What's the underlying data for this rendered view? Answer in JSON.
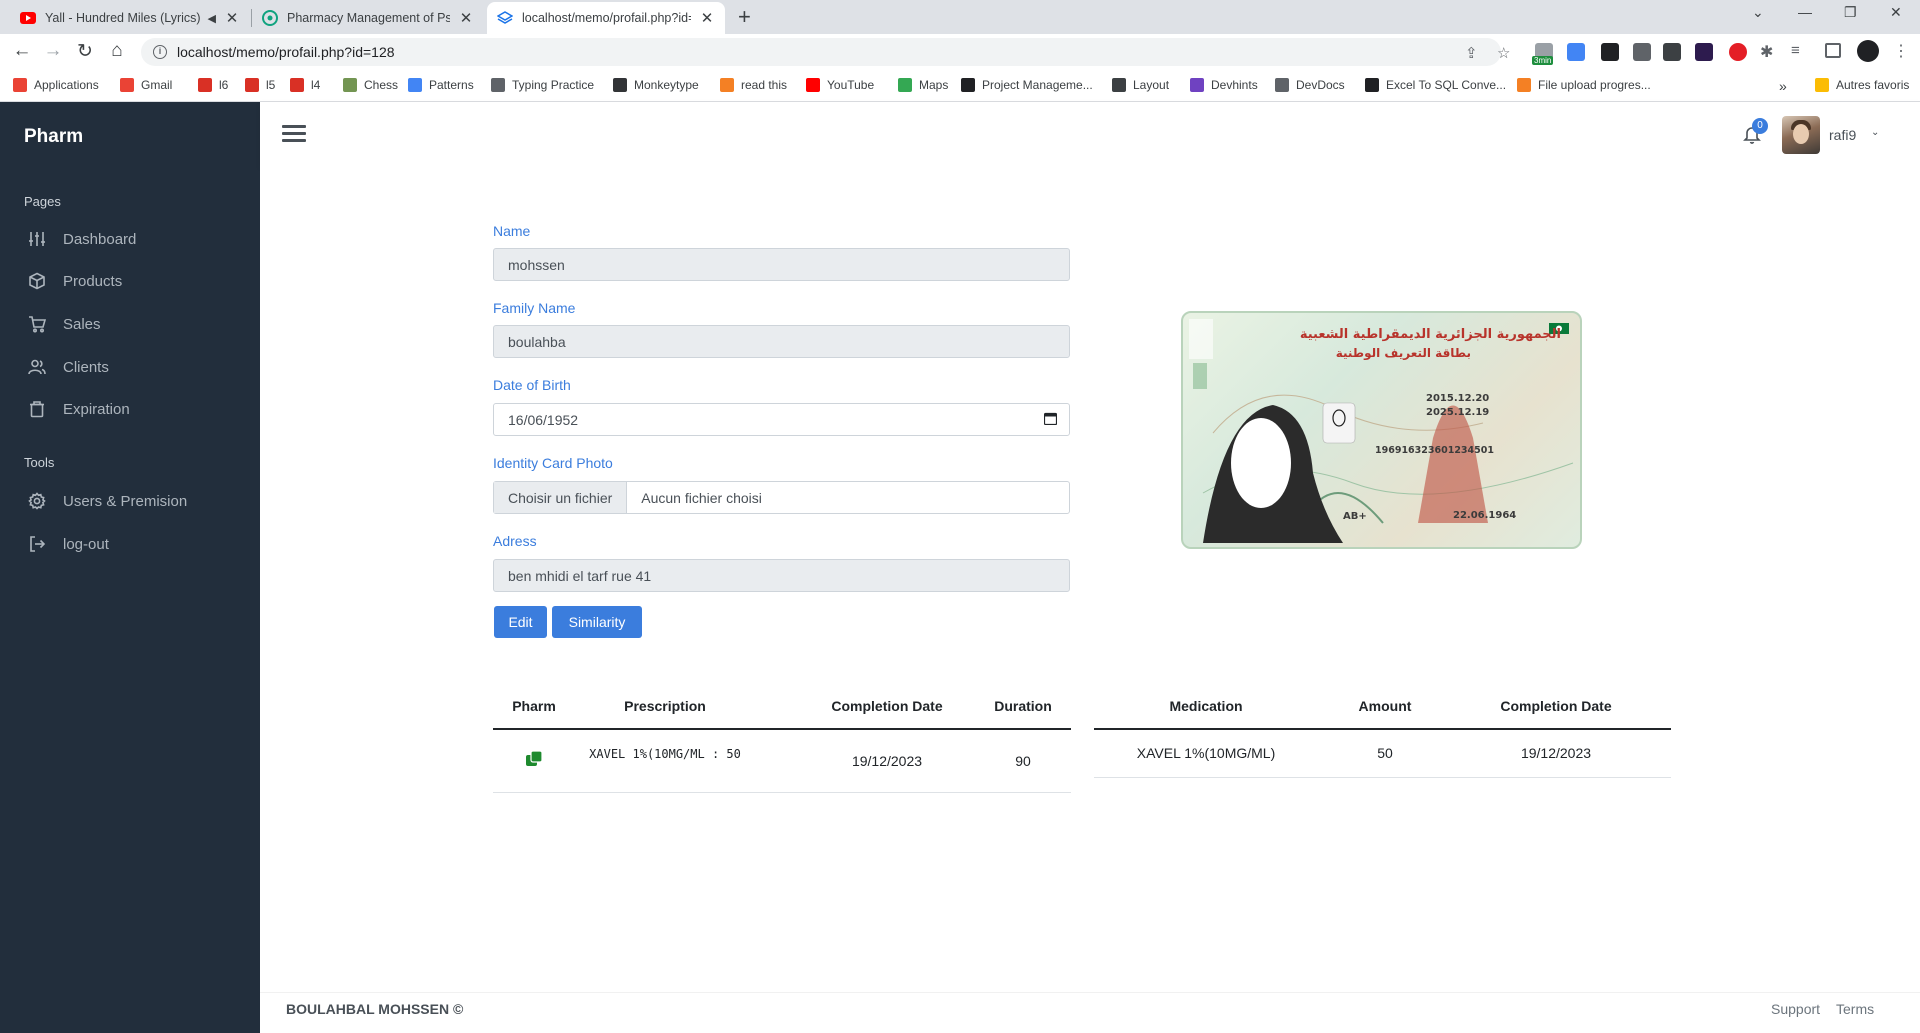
{
  "browser": {
    "tabs": [
      {
        "title": "Yall - Hundred Miles (Lyrics) (",
        "favicon": "youtube-icon"
      },
      {
        "title": "Pharmacy Management of Psych",
        "favicon": "openai-icon"
      },
      {
        "title": "localhost/memo/profail.php?id=",
        "favicon": "layers-icon"
      }
    ],
    "url": "localhost/memo/profail.php?id=128",
    "extension_badge": "3min",
    "bookmarks": [
      {
        "label": "Applications",
        "icon": "apps-grid-icon",
        "color": "#ea4335"
      },
      {
        "label": "Gmail",
        "icon": "gmail-icon",
        "color": "#ea4335"
      },
      {
        "label": "l6",
        "icon": "link-icon",
        "color": "#d93025"
      },
      {
        "label": "l5",
        "icon": "link-icon",
        "color": "#d93025"
      },
      {
        "label": "l4",
        "icon": "link-icon",
        "color": "#d93025"
      },
      {
        "label": "Chess",
        "icon": "pawn-icon",
        "color": "#739552"
      },
      {
        "label": "Patterns",
        "icon": "patterns-icon",
        "color": "#4285f4"
      },
      {
        "label": "Typing Practice",
        "icon": "keyboard-icon",
        "color": "#5f6368"
      },
      {
        "label": "Monkeytype",
        "icon": "monkeytype-icon",
        "color": "#323437"
      },
      {
        "label": "read this",
        "icon": "stackoverflow-icon",
        "color": "#f48024"
      },
      {
        "label": "YouTube",
        "icon": "youtube-icon",
        "color": "#ff0000"
      },
      {
        "label": "Maps",
        "icon": "maps-pin-icon",
        "color": "#34a853"
      },
      {
        "label": "Project Manageme...",
        "icon": "project-icon",
        "color": "#202124"
      },
      {
        "label": "Layout",
        "icon": "globe-icon",
        "color": "#3c4043"
      },
      {
        "label": "Devhints",
        "icon": "devhints-icon",
        "color": "#6f42c1"
      },
      {
        "label": "DevDocs",
        "icon": "devdocs-icon",
        "color": "#5f6368"
      },
      {
        "label": "Excel To SQL Conve...",
        "icon": "bt-icon",
        "color": "#202124"
      },
      {
        "label": "File upload progres...",
        "icon": "stackoverflow-icon",
        "color": "#f48024"
      }
    ],
    "other_bookmarks": "Autres favoris",
    "more_chevron": "»"
  },
  "sidebar": {
    "brand": "Pharm",
    "section_pages": "Pages",
    "pages": [
      {
        "label": "Dashboard",
        "icon": "sliders-icon"
      },
      {
        "label": "Products",
        "icon": "package-icon"
      },
      {
        "label": "Sales",
        "icon": "shopping-cart-icon"
      },
      {
        "label": "Clients",
        "icon": "users-icon"
      },
      {
        "label": "Expiration",
        "icon": "trash-icon"
      }
    ],
    "section_tools": "Tools",
    "tools": [
      {
        "label": "Users & Premision",
        "icon": "settings-icon"
      },
      {
        "label": "log-out",
        "icon": "log-out-icon"
      }
    ]
  },
  "navbar": {
    "notification_count": "0",
    "username": "rafi9"
  },
  "form": {
    "name_label": "Name",
    "name_value": "mohssen",
    "family_label": "Family Name",
    "family_value": "boulahba",
    "dob_label": "Date of Birth",
    "dob_value": "16/06/1952",
    "idcard_label": "Identity Card Photo",
    "file_button": "Choisir un fichier",
    "file_status": "Aucun fichier choisi",
    "address_label": "Adress",
    "address_value": "ben mhidi el tarf rue 41",
    "edit_button": "Edit",
    "similarity_button": "Similarity"
  },
  "idcard": {
    "title_ar_1": "الجمهورية الجزائرية الديمقراطية الشعبية",
    "title_ar_2": "بطاقة التعريف الوطنية",
    "issue_date": "2015.12.20",
    "expiry_date": "2025.12.19",
    "national_number": "196916323601234501",
    "blood_type": "AB+",
    "birth_date": "22.06.1964"
  },
  "prescription_table": {
    "headers": [
      "Pharm",
      "Prescription",
      "Completion Date",
      "Duration"
    ],
    "rows": [
      {
        "prescription": "XAVEL 1%(10MG/ML : 50",
        "completion_date": "19/12/2023",
        "duration": "90"
      }
    ]
  },
  "medication_table": {
    "headers": [
      "Medication",
      "Amount",
      "Completion Date"
    ],
    "rows": [
      {
        "medication": "XAVEL 1%(10MG/ML)",
        "amount": "50",
        "completion_date": "19/12/2023"
      }
    ]
  },
  "footer": {
    "copyright": "BOULAHBAL MOHSSEN ©",
    "support": "Support",
    "terms": "Terms"
  },
  "colors": {
    "sidebar_bg": "#222e3c",
    "accent": "#3b7ddd",
    "pharm_icon": "#1e8a2e"
  }
}
